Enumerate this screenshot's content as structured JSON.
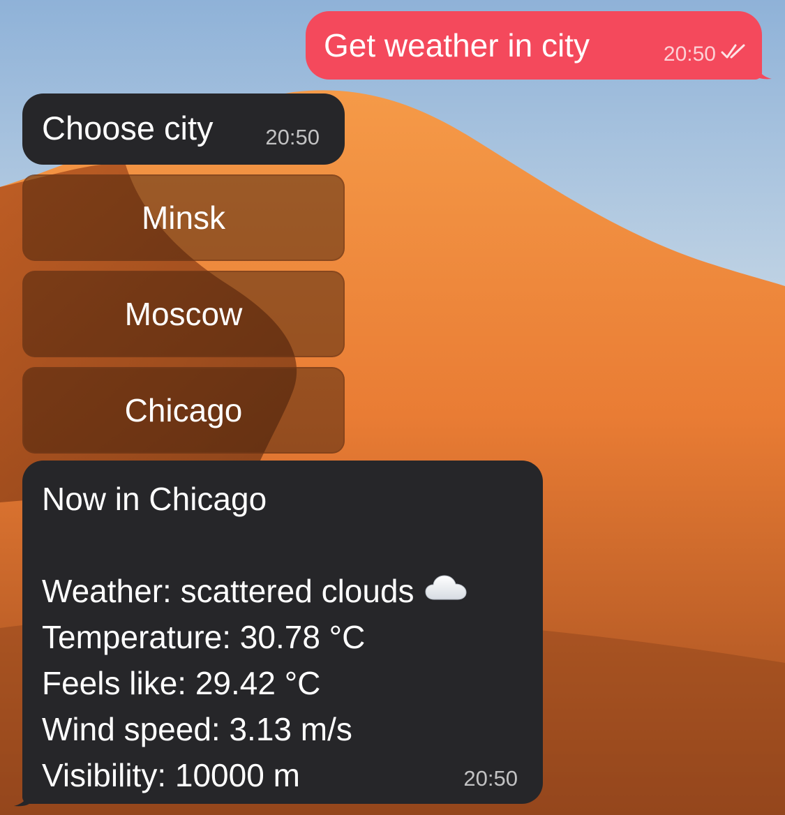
{
  "messages": {
    "request": {
      "text": "Get weather in city",
      "time": "20:50",
      "status_icon": "double-check-icon"
    },
    "prompt": {
      "text": "Choose city",
      "time": "20:50"
    },
    "keyboard": {
      "buttons": [
        "Minsk",
        "Moscow",
        "Chicago"
      ]
    },
    "weather": {
      "title": "Now in Chicago",
      "weather_line": "Weather: scattered clouds",
      "weather_icon": "cloud-icon",
      "temperature_line": "Temperature: 30.78 °C",
      "feels_like_line": "Feels like: 29.42 °C",
      "wind_line": "Wind speed: 3.13 m/s",
      "visibility_line": "Visibility: 10000 m",
      "time": "20:50"
    }
  },
  "colors": {
    "outgoing_bubble": "#f4495c",
    "incoming_bubble": "#262629",
    "dune": "#f08a3c",
    "sky": "#a9c3df"
  }
}
